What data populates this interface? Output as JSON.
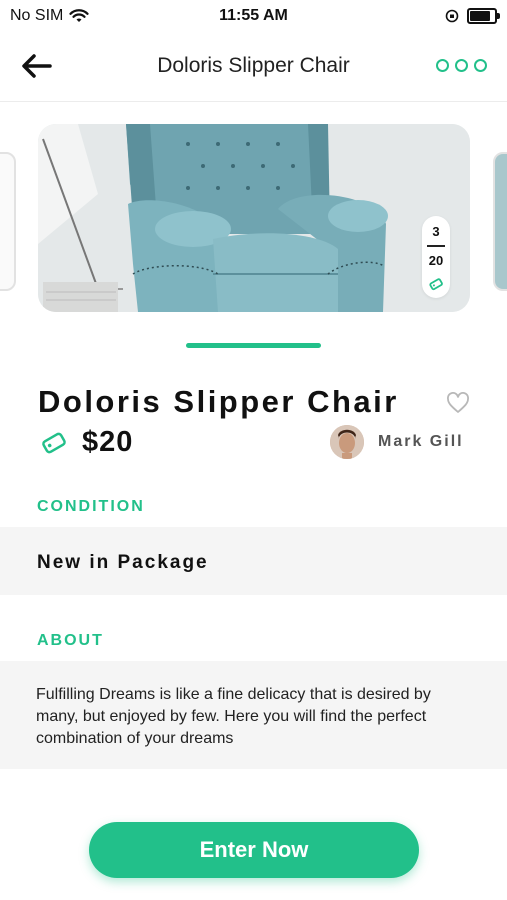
{
  "status_bar": {
    "carrier": "No SIM",
    "time": "11:55 AM",
    "battery_level": 0.9
  },
  "navbar": {
    "title": "Doloris Slipper Chair",
    "icons": {
      "back": "arrow-left-icon",
      "more": "more-dots-icon"
    }
  },
  "gallery": {
    "current": "3",
    "total": "20",
    "tag_icon": "tag-icon"
  },
  "product": {
    "title": "Doloris Slipper Chair",
    "price": "$20",
    "seller_name": "Mark Gill"
  },
  "condition": {
    "label": "CONDITION",
    "value": "New in Package"
  },
  "about": {
    "label": "ABOUT",
    "text": "Fulfilling Dreams is like a fine delicacy that is desired by many, but enjoyed by few. Here you will find the perfect combination of your dreams"
  },
  "cta": {
    "label": "Enter Now"
  },
  "colors": {
    "accent": "#22c08a",
    "band": "#f5f5f5"
  }
}
